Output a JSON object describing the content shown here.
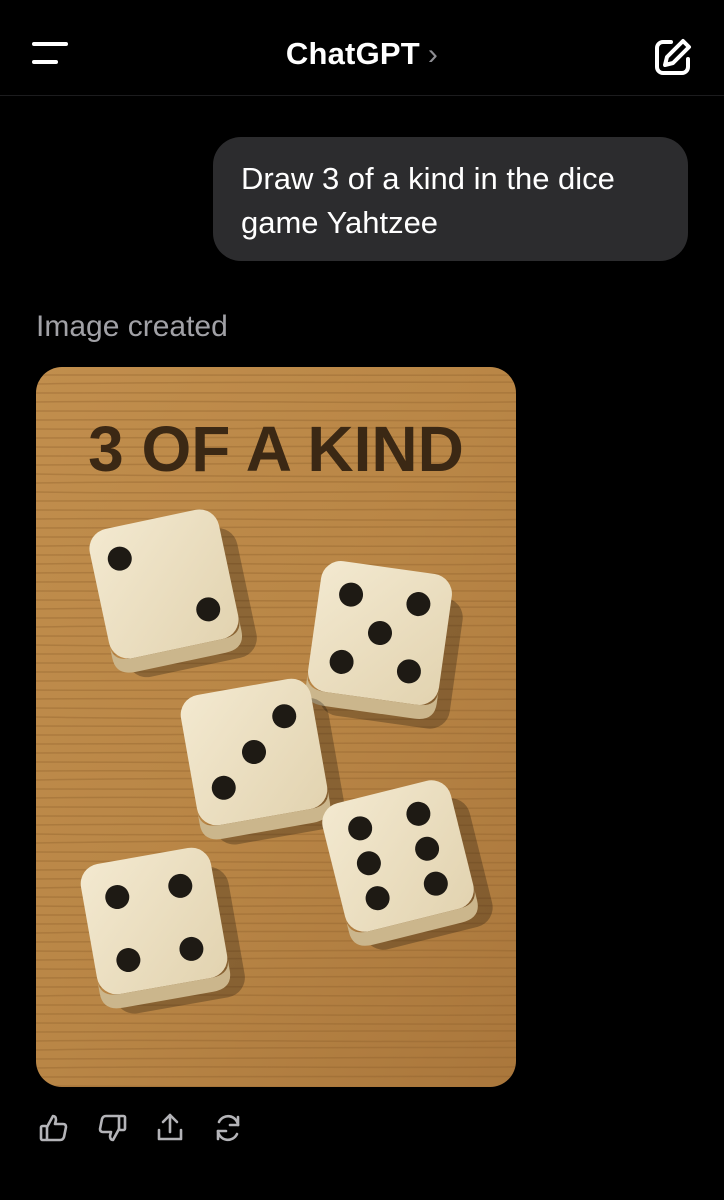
{
  "header": {
    "title": "ChatGPT",
    "chevron": "›",
    "menu_icon": "menu-icon",
    "new_chat_icon": "compose-icon"
  },
  "conversation": {
    "user_message": "Draw 3 of a kind in the dice game Yahtzee",
    "assistant_status": "Image created",
    "generated_image": {
      "heading": "3 OF A KIND",
      "dice_faces": [
        2,
        5,
        3,
        6,
        4
      ]
    }
  },
  "actions": [
    {
      "icon": "thumbs-up-icon"
    },
    {
      "icon": "thumbs-down-icon"
    },
    {
      "icon": "share-icon"
    },
    {
      "icon": "regenerate-icon"
    }
  ],
  "colors": {
    "background": "#000000",
    "bubble": "#2c2c2e",
    "muted_text": "#a1a1a6",
    "wood": "#b98646",
    "die_face": "#ece0c4",
    "pip": "#1e1a14"
  }
}
